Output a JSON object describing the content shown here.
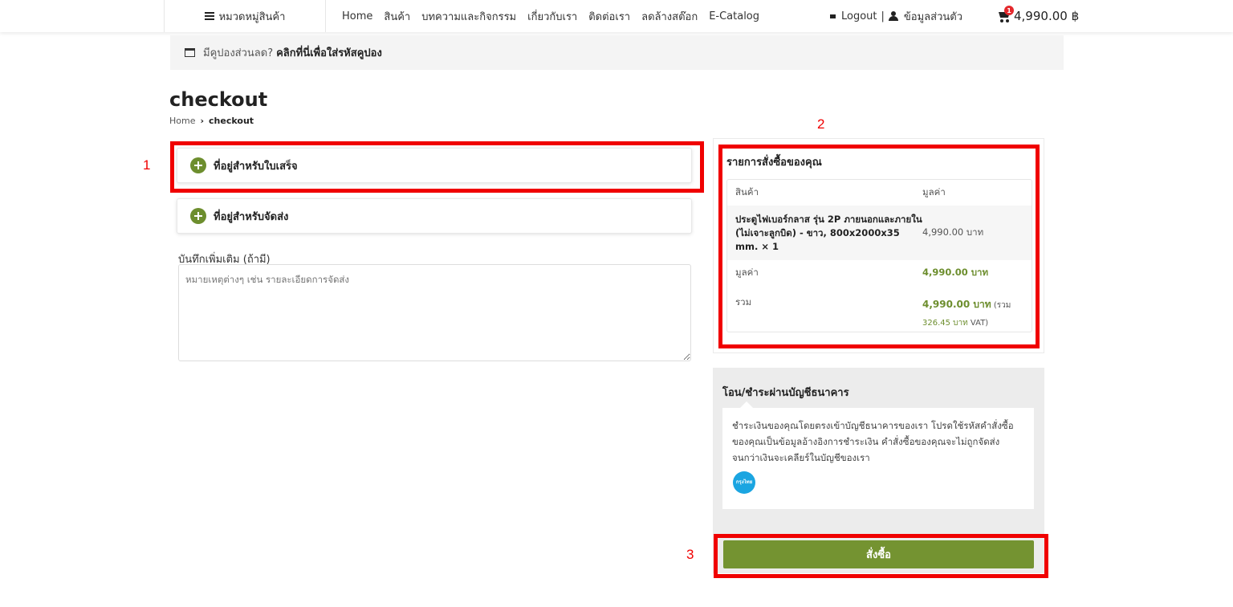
{
  "header": {
    "category_menu": "หมวดหมู่สินค้า",
    "nav": [
      "Home",
      "สินค้า",
      "บทความและกิจกรรม",
      "เกี่ยวกับเรา",
      "ติดต่อเรา",
      "ลดล้างสต๊อก",
      "E-Catalog"
    ],
    "logout": "Logout",
    "divider": "|",
    "profile": "ข้อมูลส่วนตัว",
    "cart_count": "1",
    "cart_total": "4,990.00 ฿"
  },
  "coupon": {
    "question": "มีคูปองส่วนลด?",
    "link": "คลิกที่นี่เพื่อใส่รหัสคูปอง"
  },
  "page": {
    "title": "checkout",
    "breadcrumb_home": "Home",
    "breadcrumb_sep": "›",
    "breadcrumb_current": "checkout"
  },
  "forms": {
    "billing": "ที่อยู่สำหรับใบเสร็จ",
    "shipping": "ที่อยู่สำหรับจัดส่ง",
    "note_label": "บันทึกเพิ่มเติม (ถ้ามี)",
    "note_placeholder": "หมายเหตุต่างๆ เช่น รายละเอียดการจัดส่ง"
  },
  "order": {
    "title": "รายการสั่งซื้อของคุณ",
    "col_product": "สินค้า",
    "col_price": "มูลค่า",
    "product_name": "ประตูไฟเบอร์กลาส รุ่น 2P ภายนอกและภายใน (ไม่เจาะลูกบิด) - ขาว, 800x2000x35 mm.",
    "product_qty": "× 1",
    "product_price": "4,990.00 บาท",
    "subtotal_label": "มูลค่า",
    "subtotal_value": "4,990.00 บาท",
    "total_label": "รวม",
    "total_value": "4,990.00 บาท",
    "vat_prefix": "(รวม",
    "vat_amount": "326.45 บาท",
    "vat_suffix": "VAT)"
  },
  "payment": {
    "title": "โอน/ชำระผ่านบัญชีธนาคาร",
    "description": "ชำระเงินของคุณโดยตรงเข้าบัญชีธนาคารของเรา โปรดใช้รหัสคำสั่งซื้อของคุณเป็นข้อมูลอ้างอิงการชำระเงิน คำสั่งซื้อของคุณจะไม่ถูกจัดส่งจนกว่าเงินจะเคลียร์ในบัญชีของเรา",
    "bank_logo_text": "กรุงไทย",
    "place_order": "สั่งซื้อ"
  },
  "annotations": {
    "one": "1",
    "two": "2",
    "three": "3",
    "color": "#f00000"
  },
  "colors": {
    "accent": "#749331",
    "badge": "#e4282c",
    "bank": "#1ba5e1"
  }
}
